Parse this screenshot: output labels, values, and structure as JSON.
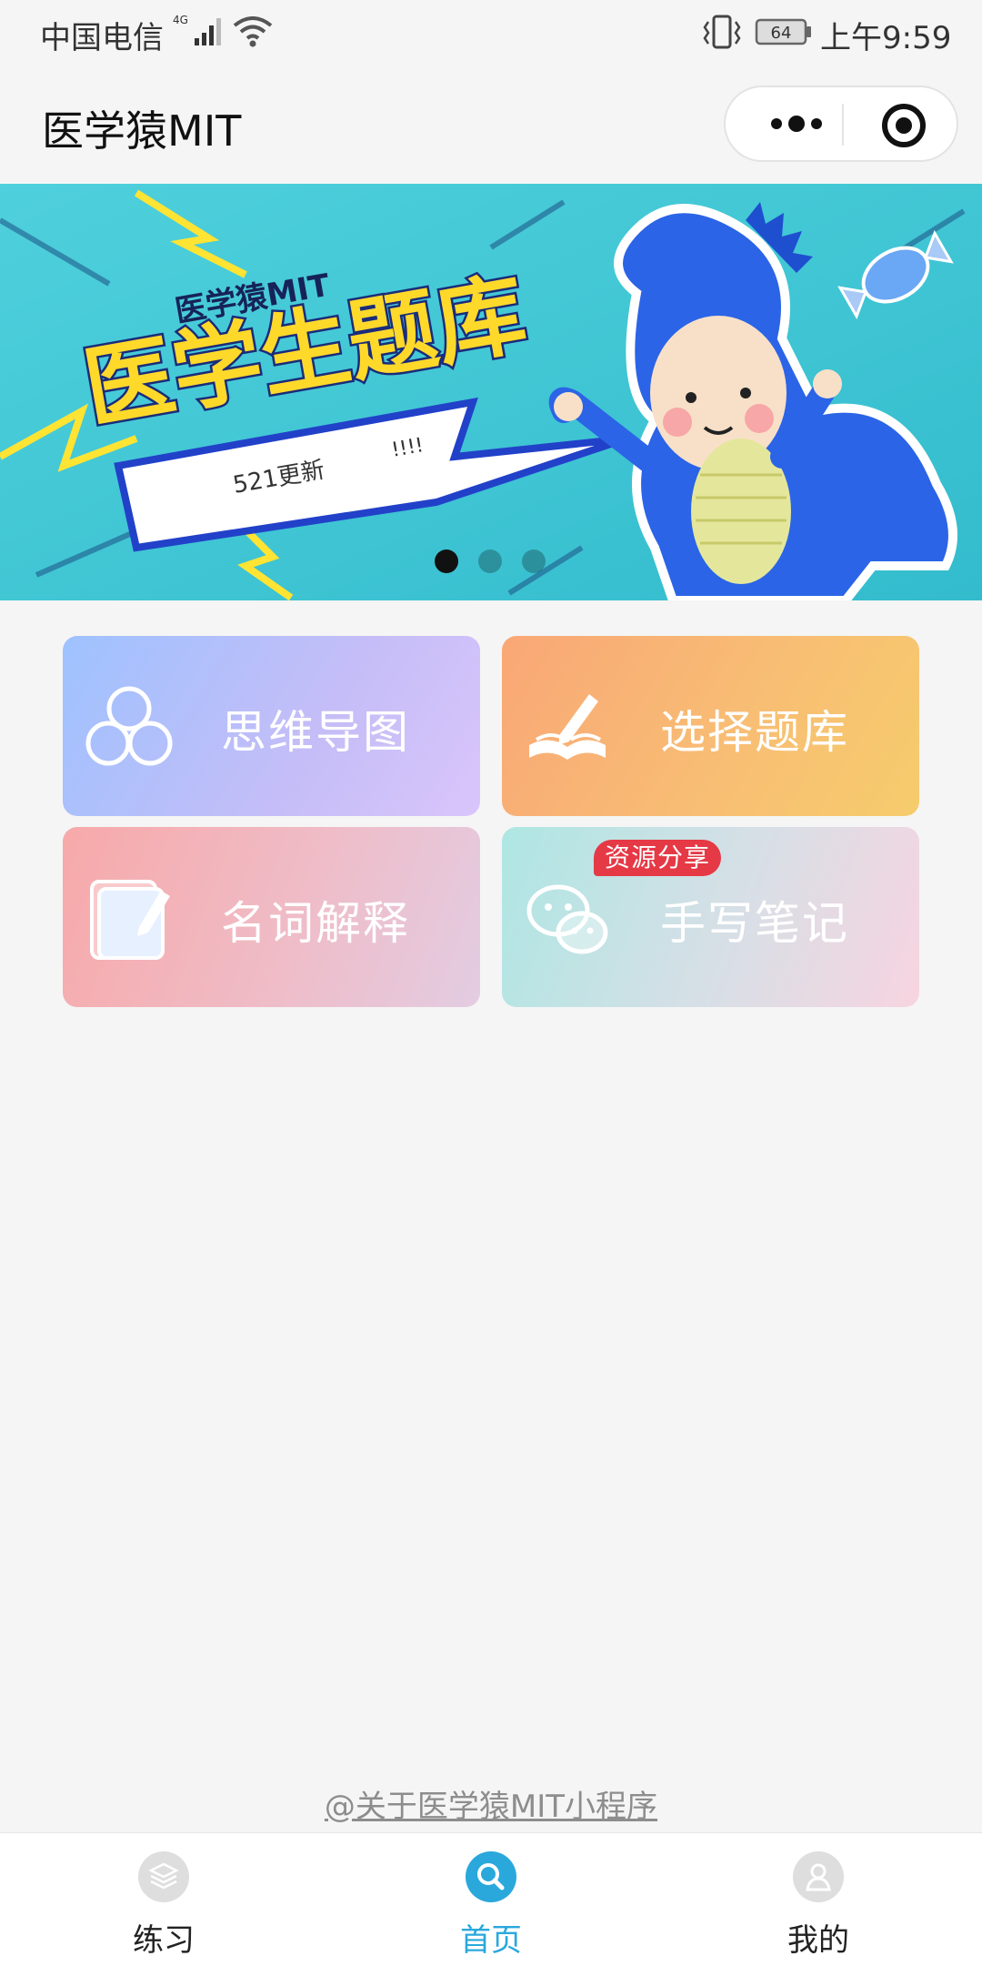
{
  "status_bar": {
    "carrier": "中国电信",
    "network": "4G",
    "battery": "64",
    "time": "上午9:59"
  },
  "nav": {
    "title": "医学猿MIT"
  },
  "banner": {
    "brand": "医学猿MIT",
    "headline": "医学生题库",
    "tag": "521更新",
    "exclaim": "!!!!",
    "slide_count": 3,
    "active_slide": 1
  },
  "tiles": [
    {
      "label": "思维导图",
      "icon": "mind-map-icon"
    },
    {
      "label": "选择题库",
      "icon": "book-pen-icon"
    },
    {
      "label": "名词解释",
      "icon": "notepad-pen-icon"
    },
    {
      "label": "手写笔记",
      "icon": "wechat-icon",
      "badge": "资源分享"
    }
  ],
  "footer": {
    "about_link": "@关于医学猿MIT小程序"
  },
  "tabbar": [
    {
      "label": "练习",
      "icon": "layers-icon",
      "active": false
    },
    {
      "label": "首页",
      "icon": "search-icon",
      "active": true
    },
    {
      "label": "我的",
      "icon": "user-icon",
      "active": false
    }
  ],
  "colors": {
    "accent": "#2aa8dc",
    "badge": "#e53945",
    "banner_bg": "#3fc8d6"
  }
}
